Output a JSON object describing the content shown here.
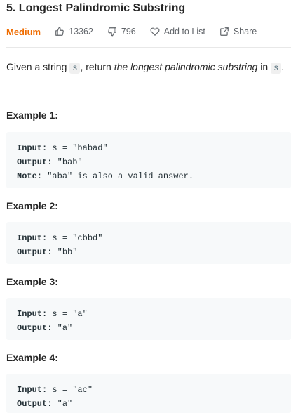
{
  "problem": {
    "title": "5. Longest Palindromic Substring",
    "difficulty": "Medium",
    "likes": "13362",
    "dislikes": "796",
    "add_to_list": "Add to List",
    "share": "Share",
    "difficulty_color": "#ef6c00"
  },
  "description": {
    "prefix": "Given a string ",
    "var": "s",
    "middle": ", return ",
    "emphasis": "the longest palindromic substring",
    "suffix": " in ",
    "var2": "s",
    "end": "."
  },
  "examples": [
    {
      "heading": "Example 1:",
      "lines": [
        {
          "label": "Input:",
          "value": " s = \"babad\""
        },
        {
          "label": "Output:",
          "value": " \"bab\""
        },
        {
          "label": "Note:",
          "value": " \"aba\" is also a valid answer."
        }
      ]
    },
    {
      "heading": "Example 2:",
      "lines": [
        {
          "label": "Input:",
          "value": " s = \"cbbd\""
        },
        {
          "label": "Output:",
          "value": " \"bb\""
        }
      ]
    },
    {
      "heading": "Example 3:",
      "lines": [
        {
          "label": "Input:",
          "value": " s = \"a\""
        },
        {
          "label": "Output:",
          "value": " \"a\""
        }
      ]
    },
    {
      "heading": "Example 4:",
      "lines": [
        {
          "label": "Input:",
          "value": " s = \"ac\""
        },
        {
          "label": "Output:",
          "value": " \"a\""
        }
      ]
    }
  ]
}
